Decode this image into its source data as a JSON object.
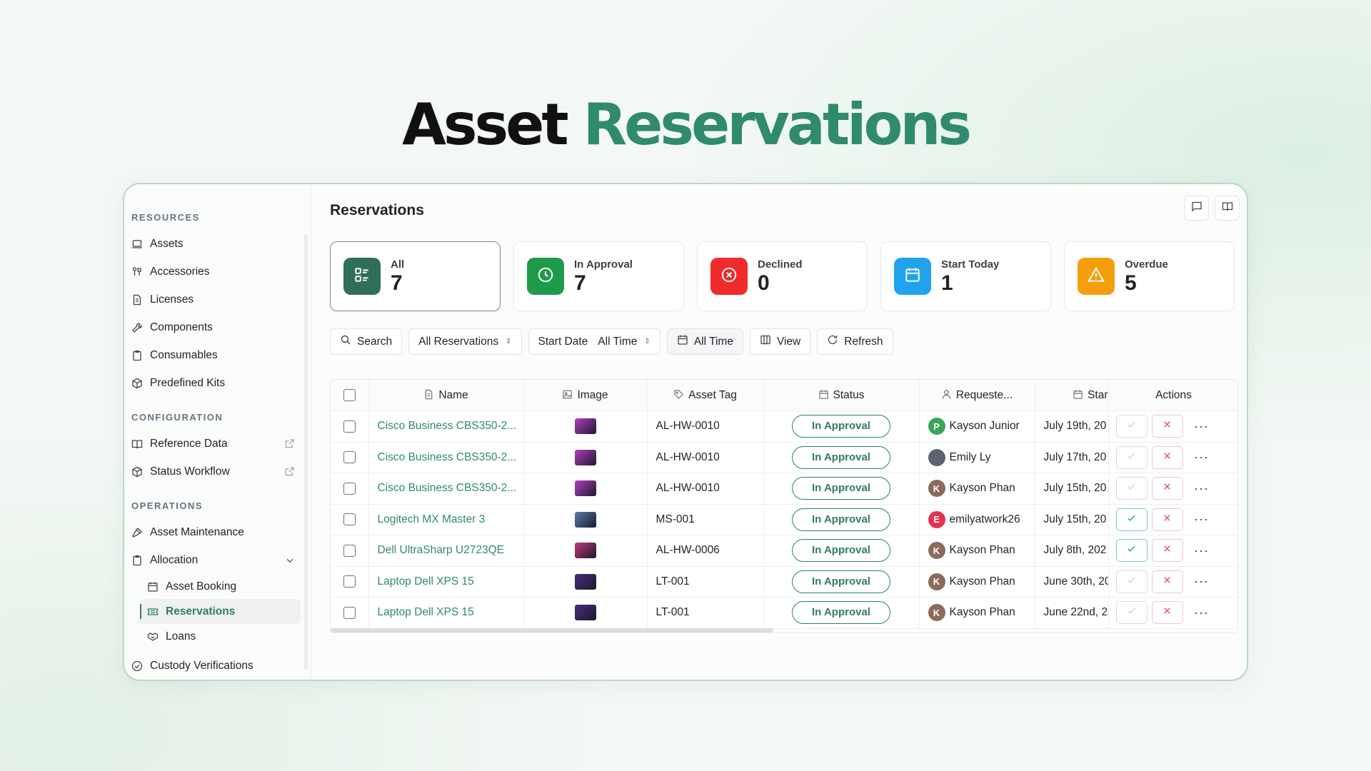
{
  "hero": {
    "word1": "Asset",
    "word2": "Reservations"
  },
  "sidebar": {
    "resources_heading": "RESOURCES",
    "resources": [
      {
        "label": "Assets",
        "icon": "laptop-icon"
      },
      {
        "label": "Accessories",
        "icon": "accessories-icon"
      },
      {
        "label": "Licenses",
        "icon": "document-icon"
      },
      {
        "label": "Components",
        "icon": "wrench-icon"
      },
      {
        "label": "Consumables",
        "icon": "clipboard-icon"
      },
      {
        "label": "Predefined Kits",
        "icon": "package-icon"
      }
    ],
    "configuration_heading": "CONFIGURATION",
    "configuration": [
      {
        "label": "Reference Data",
        "icon": "book-icon"
      },
      {
        "label": "Status Workflow",
        "icon": "package-icon"
      }
    ],
    "operations_heading": "OPERATIONS",
    "operations": [
      {
        "label": "Asset Maintenance",
        "icon": "hammer-icon"
      },
      {
        "label": "Allocation",
        "icon": "clipboard-icon"
      }
    ],
    "allocation_sub": [
      {
        "label": "Asset Booking",
        "icon": "calendar-icon"
      },
      {
        "label": "Reservations",
        "icon": "ticket-icon"
      },
      {
        "label": "Loans",
        "icon": "handshake-icon"
      }
    ],
    "custody": {
      "label": "Custody Verifications",
      "icon": "check-circle-icon"
    }
  },
  "main": {
    "title": "Reservations",
    "stats": [
      {
        "label": "All",
        "value": "7",
        "color": "#2f6f5a"
      },
      {
        "label": "In Approval",
        "value": "7",
        "color": "#1f9a4a"
      },
      {
        "label": "Declined",
        "value": "0",
        "color": "#ef2b2b"
      },
      {
        "label": "Start Today",
        "value": "1",
        "color": "#1fa3ef"
      },
      {
        "label": "Overdue",
        "value": "5",
        "color": "#f59e0b"
      }
    ],
    "toolbar": {
      "search": "Search",
      "filter_all": "All Reservations",
      "start_date": "Start Date",
      "start_date_value": "All Time",
      "time_range": "All Time",
      "view": "View",
      "refresh": "Refresh"
    },
    "columns": {
      "name": "Name",
      "image": "Image",
      "asset_tag": "Asset Tag",
      "status": "Status",
      "requested_by": "Requeste...",
      "start": "Star",
      "actions": "Actions"
    },
    "rows": [
      {
        "name": "Cisco Business CBS350-2...",
        "tag": "AL-HW-0010",
        "status": "In Approval",
        "requester": "Kayson Junior",
        "avatar": "P",
        "avatar_color": "#3aa45a",
        "start": "July 19th, 20",
        "thumb": "#b33fbf",
        "approve_enabled": false
      },
      {
        "name": "Cisco Business CBS350-2...",
        "tag": "AL-HW-0010",
        "status": "In Approval",
        "requester": "Emily Ly",
        "avatar": "",
        "avatar_color": "#5b6470",
        "start": "July 17th, 20",
        "thumb": "#b33fbf",
        "approve_enabled": false
      },
      {
        "name": "Cisco Business CBS350-2...",
        "tag": "AL-HW-0010",
        "status": "In Approval",
        "requester": "Kayson Phan",
        "avatar": "K",
        "avatar_color": "#8b6a5a",
        "start": "July 15th, 20",
        "thumb": "#b33fbf",
        "approve_enabled": false
      },
      {
        "name": "Logitech MX Master 3",
        "tag": "MS-001",
        "status": "In Approval",
        "requester": "emilyatwork26",
        "avatar": "E",
        "avatar_color": "#e2334f",
        "start": "July 15th, 20",
        "thumb": "#5a7fa8",
        "approve_enabled": true
      },
      {
        "name": "Dell UltraSharp U2723QE",
        "tag": "AL-HW-0006",
        "status": "In Approval",
        "requester": "Kayson Phan",
        "avatar": "K",
        "avatar_color": "#8b6a5a",
        "start": "July 8th, 202",
        "thumb": "#c0397a",
        "approve_enabled": true
      },
      {
        "name": "Laptop Dell XPS 15",
        "tag": "LT-001",
        "status": "In Approval",
        "requester": "Kayson Phan",
        "avatar": "K",
        "avatar_color": "#8b6a5a",
        "start": "June 30th, 20",
        "thumb": "#4a2d7a",
        "approve_enabled": false
      },
      {
        "name": "Laptop Dell XPS 15",
        "tag": "LT-001",
        "status": "In Approval",
        "requester": "Kayson Phan",
        "avatar": "K",
        "avatar_color": "#8b6a5a",
        "start": "June 22nd, 2",
        "thumb": "#4a2d7a",
        "approve_enabled": false
      }
    ],
    "more_label": "···"
  }
}
